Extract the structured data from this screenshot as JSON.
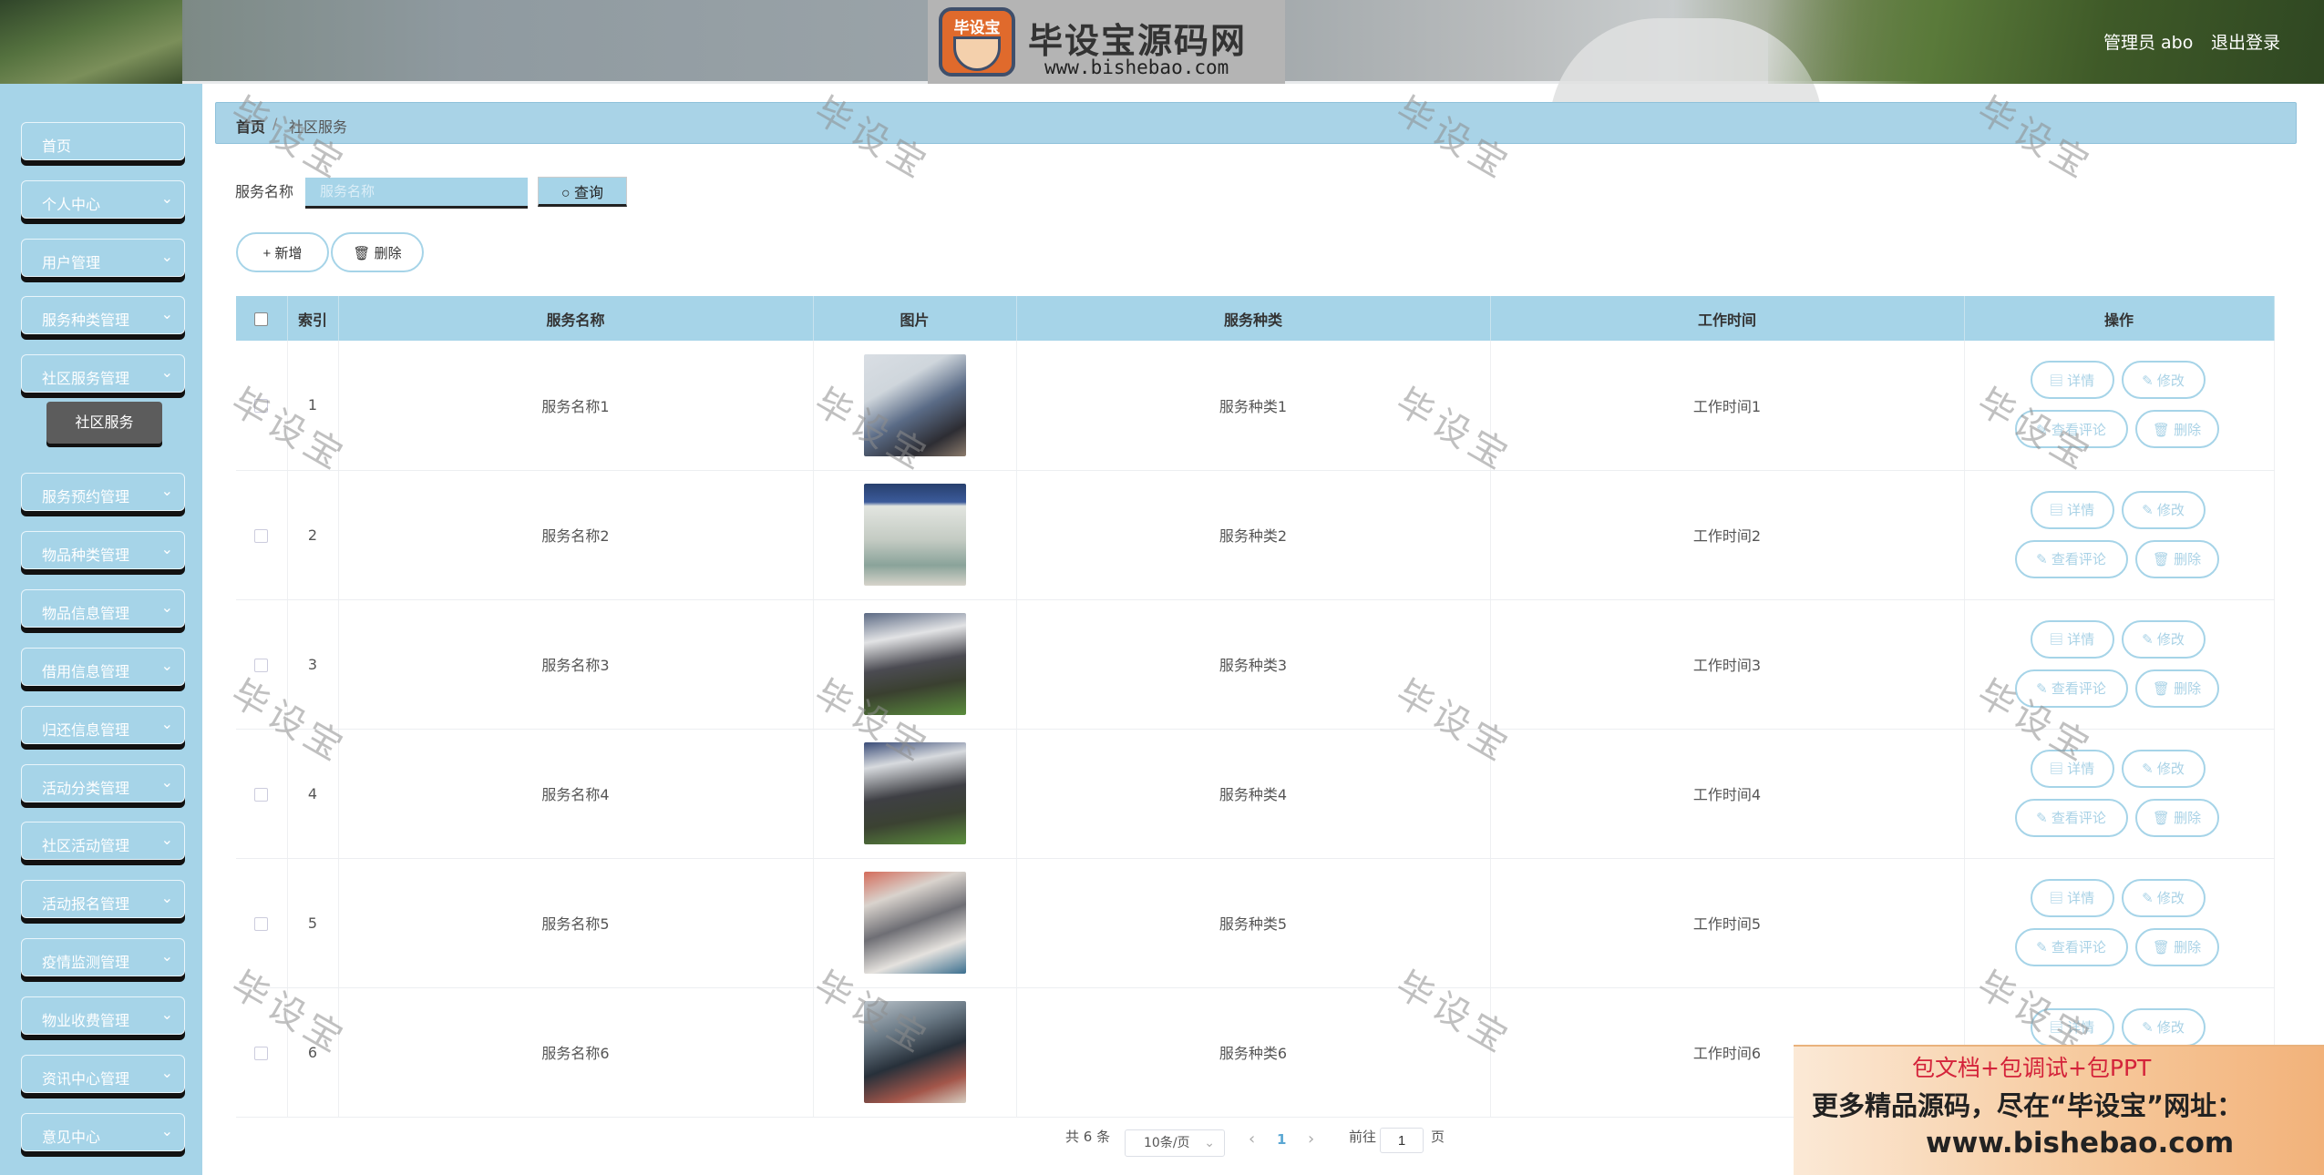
{
  "header": {
    "logo_badge": "毕设宝",
    "logo_title": "毕设宝源码网",
    "logo_url": "www.bishebao.com",
    "admin": "管理员 abo",
    "logout": "退出登录"
  },
  "sidebar": {
    "items": [
      {
        "label": "首页",
        "chevron": false
      },
      {
        "label": "个人中心",
        "chevron": true
      },
      {
        "label": "用户管理",
        "chevron": true
      },
      {
        "label": "服务种类管理",
        "chevron": true
      },
      {
        "label": "社区服务管理",
        "chevron": true
      },
      {
        "label": "服务预约管理",
        "chevron": true
      },
      {
        "label": "物品种类管理",
        "chevron": true
      },
      {
        "label": "物品信息管理",
        "chevron": true
      },
      {
        "label": "借用信息管理",
        "chevron": true
      },
      {
        "label": "归还信息管理",
        "chevron": true
      },
      {
        "label": "活动分类管理",
        "chevron": true
      },
      {
        "label": "社区活动管理",
        "chevron": true
      },
      {
        "label": "活动报名管理",
        "chevron": true
      },
      {
        "label": "疫情监测管理",
        "chevron": true
      },
      {
        "label": "物业收费管理",
        "chevron": true
      },
      {
        "label": "资讯中心管理",
        "chevron": true
      },
      {
        "label": "意见中心",
        "chevron": true
      }
    ],
    "active_sub": "社区服务"
  },
  "breadcrumb": {
    "home": "首页",
    "sep": "/",
    "current": "社区服务"
  },
  "search": {
    "label": "服务名称",
    "placeholder": "服务名称",
    "value": "",
    "button": "查询"
  },
  "actions": {
    "add": "新增",
    "delete": "删除"
  },
  "table": {
    "headers": [
      "",
      "索引",
      "服务名称",
      "图片",
      "服务种类",
      "工作时间",
      "操作"
    ],
    "rows": [
      {
        "index": "1",
        "name": "服务名称1",
        "kind": "服务种类1",
        "time": "工作时间1"
      },
      {
        "index": "2",
        "name": "服务名称2",
        "kind": "服务种类2",
        "time": "工作时间2"
      },
      {
        "index": "3",
        "name": "服务名称3",
        "kind": "服务种类3",
        "time": "工作时间3"
      },
      {
        "index": "4",
        "name": "服务名称4",
        "kind": "服务种类4",
        "time": "工作时间4"
      },
      {
        "index": "5",
        "name": "服务名称5",
        "kind": "服务种类5",
        "time": "工作时间5"
      },
      {
        "index": "6",
        "name": "服务名称6",
        "kind": "服务种类6",
        "time": "工作时间6"
      }
    ],
    "row_actions": {
      "detail": "详情",
      "edit": "修改",
      "comments": "查看评论",
      "delete": "删除"
    }
  },
  "pagination": {
    "total": "共 6 条",
    "page_size": "10条/页",
    "current": "1",
    "goto_label": "前往",
    "goto_value": "1",
    "goto_suffix": "页"
  },
  "watermark": "毕设宝",
  "ad": {
    "line1": "包文档+包调试+包PPT",
    "line2": "更多精品源码，尽在“毕设宝”网址：",
    "line3": "www.bishebao.com"
  },
  "colors": {
    "accent": "#a6d4e8",
    "header_text": "#ffffff",
    "ad_red": "#d4233a"
  }
}
